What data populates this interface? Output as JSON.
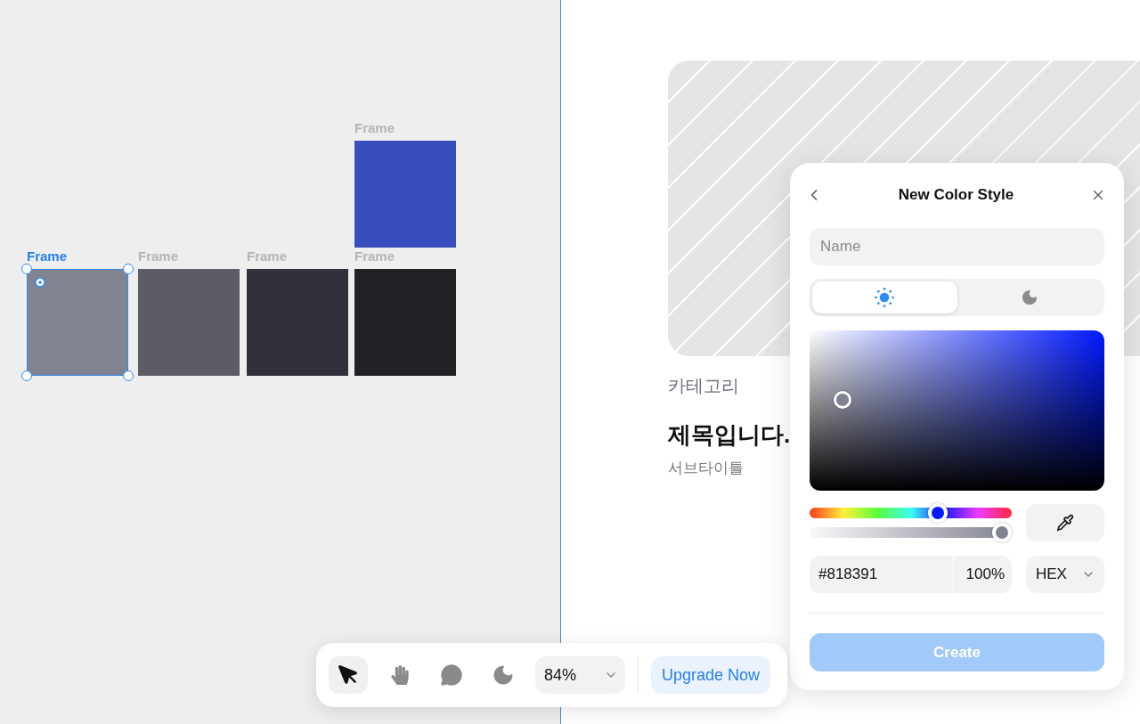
{
  "canvas": {
    "frames": [
      {
        "label": "Frame",
        "selected": false,
        "color": "#384ebd"
      },
      {
        "label": "Frame",
        "selected": true,
        "color": "#818391"
      },
      {
        "label": "Frame",
        "selected": false,
        "color": "#5c5c66"
      },
      {
        "label": "Frame",
        "selected": false,
        "color": "#31313b"
      },
      {
        "label": "Frame",
        "selected": false,
        "color": "#212226"
      }
    ]
  },
  "card": {
    "category": "카테고리",
    "title": "제목입니다.",
    "subtitle": "서브타이틀"
  },
  "color_style_panel": {
    "title": "New Color Style",
    "name_field": {
      "placeholder": "Name"
    },
    "mode_tabs": [
      {
        "kind": "light",
        "selected": true
      },
      {
        "kind": "dark",
        "selected": false
      }
    ],
    "hue_slider": {
      "level": 0.65
    },
    "opacity_slider": {
      "level": 1
    },
    "hex_value": "#818391",
    "opacity_value": "100%",
    "format_select": {
      "value": "HEX"
    },
    "create_button": {
      "label": "Create",
      "disabled": true
    }
  },
  "toolbar": {
    "tools": [
      {
        "kind": "select",
        "selected": true
      },
      {
        "kind": "hand",
        "selected": false
      },
      {
        "kind": "comment",
        "selected": false
      },
      {
        "kind": "theme",
        "selected": false
      }
    ],
    "zoom": "84%",
    "upgrade_button": "Upgrade Now"
  }
}
